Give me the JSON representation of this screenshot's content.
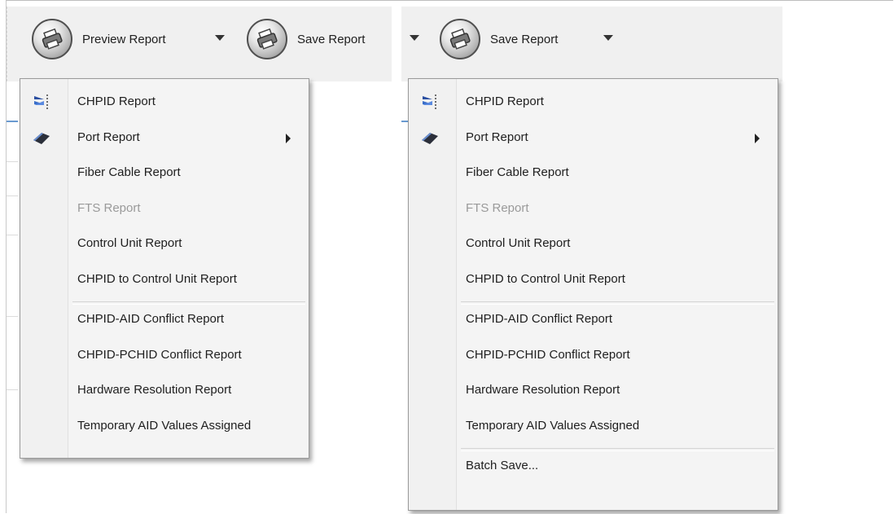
{
  "left": {
    "toolbar": {
      "preview_label": "Preview Report",
      "save_label": "Save Report"
    },
    "menu": {
      "items": [
        {
          "label": "CHPID Report",
          "icon": "chpid-report-icon",
          "disabled": false,
          "submenu": false
        },
        {
          "label": "Port Report",
          "icon": "port-chip-icon",
          "disabled": false,
          "submenu": true
        },
        {
          "label": "Fiber Cable Report",
          "disabled": false,
          "submenu": false
        },
        {
          "label": "FTS Report",
          "disabled": true,
          "submenu": false
        },
        {
          "label": "Control Unit Report",
          "disabled": false,
          "submenu": false
        },
        {
          "label": "CHPID to Control Unit Report",
          "disabled": false,
          "submenu": false
        },
        {
          "label": "CHPID-AID Conflict Report",
          "disabled": false,
          "submenu": false
        },
        {
          "label": "CHPID-PCHID Conflict Report",
          "disabled": false,
          "submenu": false
        },
        {
          "label": "Hardware Resolution Report",
          "disabled": false,
          "submenu": false
        },
        {
          "label": "Temporary AID Values Assigned",
          "disabled": false,
          "submenu": false
        }
      ]
    }
  },
  "right": {
    "toolbar": {
      "save_label": "Save Report"
    },
    "menu": {
      "items": [
        {
          "label": "CHPID Report",
          "icon": "chpid-report-icon",
          "disabled": false,
          "submenu": false
        },
        {
          "label": "Port Report",
          "icon": "port-chip-icon",
          "disabled": false,
          "submenu": true
        },
        {
          "label": "Fiber Cable Report",
          "disabled": false,
          "submenu": false
        },
        {
          "label": "FTS Report",
          "disabled": true,
          "submenu": false
        },
        {
          "label": "Control Unit Report",
          "disabled": false,
          "submenu": false
        },
        {
          "label": "CHPID to Control Unit Report",
          "disabled": false,
          "submenu": false
        },
        {
          "label": "CHPID-AID Conflict Report",
          "disabled": false,
          "submenu": false
        },
        {
          "label": "CHPID-PCHID Conflict Report",
          "disabled": false,
          "submenu": false
        },
        {
          "label": "Hardware Resolution Report",
          "disabled": false,
          "submenu": false
        },
        {
          "label": "Temporary AID Values Assigned",
          "disabled": false,
          "submenu": false
        },
        {
          "label": "Batch Save...",
          "disabled": false,
          "submenu": false
        }
      ]
    }
  },
  "colors": {
    "toolbar_bg": "#f0f0f0",
    "menu_bg": "#f4f4f4",
    "disabled_text": "#9a9a9a"
  }
}
